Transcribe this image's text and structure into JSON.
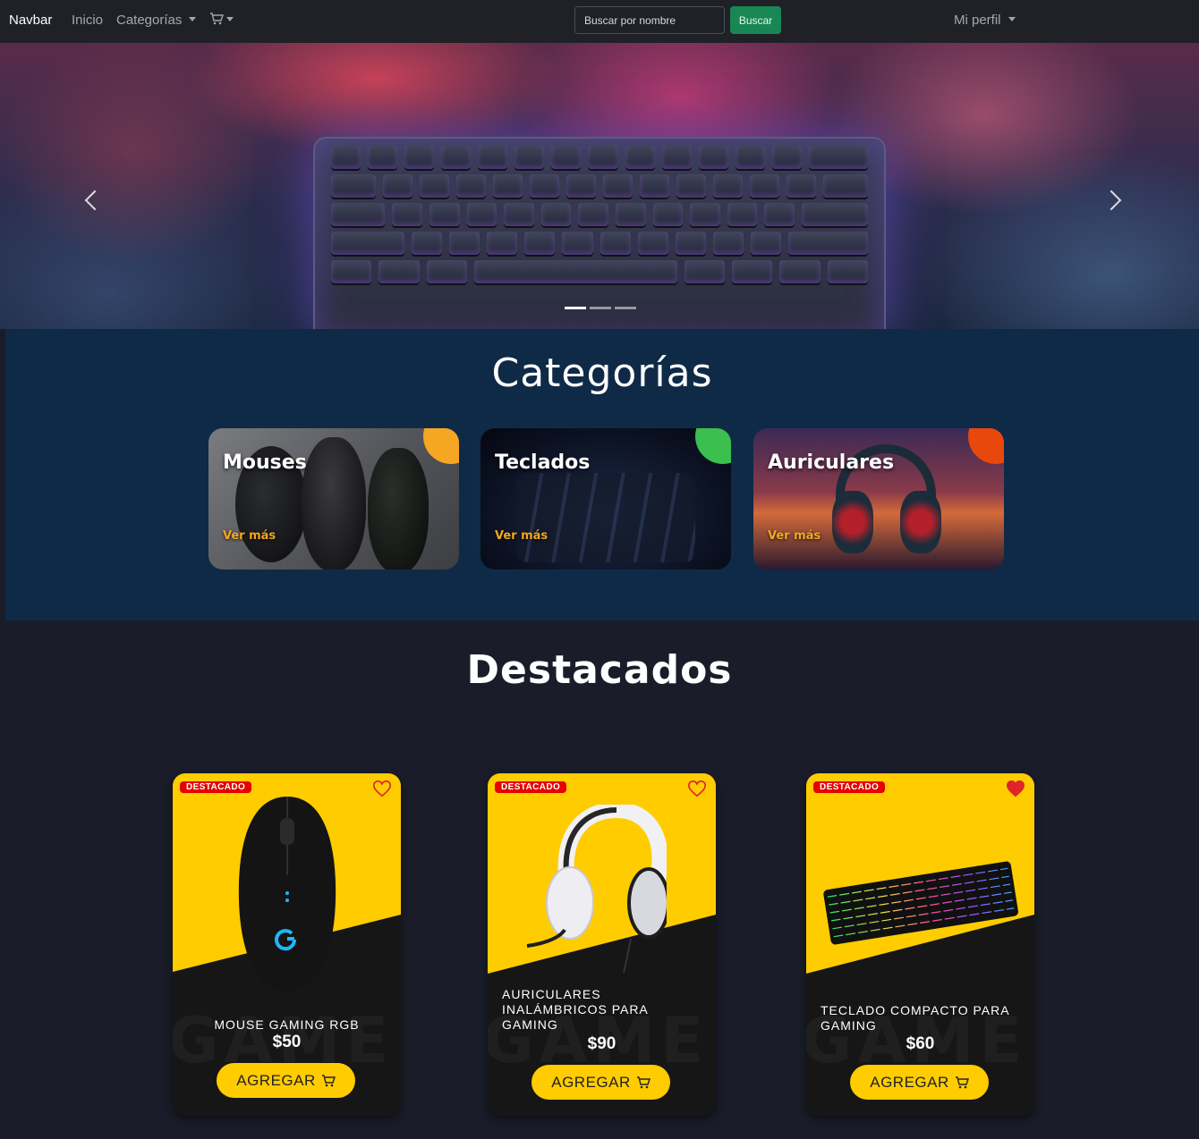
{
  "navbar": {
    "brand": "Navbar",
    "home": "Inicio",
    "categories": "Categorías",
    "cart_icon": "cart-icon",
    "search_placeholder": "Buscar por nombre",
    "search_button": "Buscar",
    "profile": "Mi perfil"
  },
  "carousel": {
    "slides": 3,
    "active_slide": 1
  },
  "categories_section": {
    "title": "Categorías",
    "items": [
      {
        "name": "Mouses",
        "more": "Ver más",
        "accent": "#f5a623"
      },
      {
        "name": "Teclados",
        "more": "Ver más",
        "accent": "#3bbf4f"
      },
      {
        "name": "Auriculares",
        "more": "Ver más",
        "accent": "#e8480c"
      }
    ]
  },
  "featured_section": {
    "title": "Destacados",
    "products": [
      {
        "badge": "DESTACADO",
        "name": "MOUSE GAMING RGB",
        "price": "$50",
        "button": "AGREGAR",
        "favorite": false
      },
      {
        "badge": "DESTACADO",
        "name": "AURICULARES INALÁMBRICOS PARA GAMING",
        "price": "$90",
        "button": "AGREGAR",
        "favorite": false
      },
      {
        "badge": "DESTACADO",
        "name": "TECLADO COMPACTO PARA GAMING",
        "price": "$60",
        "button": "AGREGAR",
        "favorite": true
      }
    ]
  },
  "colors": {
    "navbar_bg": "#1f2127",
    "search_button": "#198754",
    "category_section_bg": "#0f2a46",
    "page_bg": "#1a1d29",
    "product_yellow": "#ffcc00",
    "badge_red": "#e60000",
    "heart_red": "#e0242a",
    "see_more": "#f2a623"
  }
}
